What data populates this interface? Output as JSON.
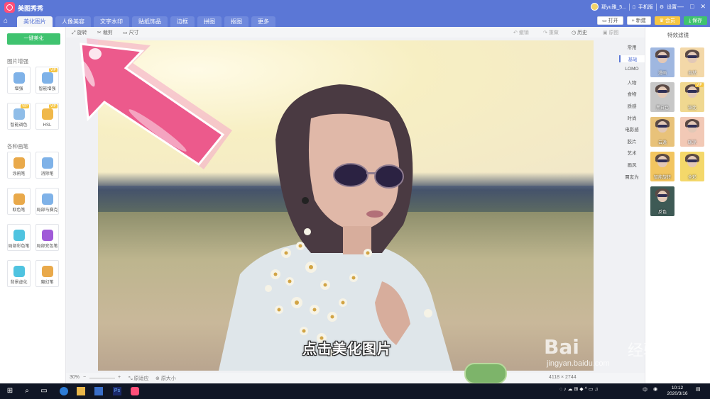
{
  "app": {
    "title": "美图秀秀",
    "user": "那yu雅_5...",
    "phone": "手机版",
    "settings": "设置"
  },
  "window_controls": [
    "—",
    "□",
    "✕"
  ],
  "tabs": [
    "美化图片",
    "人像美容",
    "文字水印",
    "贴纸饰品",
    "边框",
    "拼图",
    "抠图",
    "更多"
  ],
  "active_tab": 0,
  "top_buttons": {
    "open": "打开",
    "new": "新建",
    "vip": "会员",
    "save": "保存"
  },
  "left": {
    "auto_button": "一键美化",
    "section1": "图片增强",
    "enhance_tools": [
      {
        "label": "增强",
        "icon": "sliders-icon",
        "color": "#7fb2e8",
        "vip": ""
      },
      {
        "label": "智能增强",
        "icon": "magic-wand-icon",
        "color": "#7fb2e8",
        "vip": "VIP"
      },
      {
        "label": "智能调色",
        "icon": "palette-icon",
        "color": "#8fbde8",
        "vip": "VIP"
      },
      {
        "label": "HSL",
        "icon": "hsl-icon",
        "color": "#f0b84a",
        "vip": "VIP"
      }
    ],
    "section2": "各种画笔",
    "brush_tools": [
      {
        "label": "涂鸦笔",
        "icon": "pen-icon",
        "color": "#e9a94a"
      },
      {
        "label": "消除笔",
        "icon": "eraser-icon",
        "color": "#7fb2e8"
      },
      {
        "label": "取色笔",
        "icon": "color-picker-icon",
        "color": "#e9a94a"
      },
      {
        "label": "局部马赛克",
        "icon": "mosaic-icon",
        "color": "#7fb2e8"
      },
      {
        "label": "局部彩色笔",
        "icon": "color-brush-icon",
        "color": "#4fc3e0"
      },
      {
        "label": "局部变色笔",
        "icon": "tint-brush-icon",
        "color": "#a05ad8"
      },
      {
        "label": "背景虚化",
        "icon": "blur-icon",
        "color": "#4fc3e0"
      },
      {
        "label": "魔幻笔",
        "icon": "magic-pen-icon",
        "color": "#e9a94a"
      }
    ]
  },
  "toolbar": {
    "rotate": "旋转",
    "crop": "裁剪",
    "size": "尺寸",
    "undo": "撤销",
    "redo": "重做",
    "history": "历史",
    "compare": "原图"
  },
  "canvas": {
    "subtitle": "点击美化图片"
  },
  "statusbar": {
    "zoom": "30%",
    "fit": "原适应",
    "original": "原大小",
    "dimensions": "4118 × 2744"
  },
  "filters": {
    "title": "特效滤镜",
    "categories": [
      "常用",
      "基础",
      "LOMO",
      "人物",
      "食物",
      "质感",
      "时尚",
      "电影感",
      "胶片",
      "艺术",
      "画风",
      "賈友为"
    ],
    "active_category": 1,
    "tiles": [
      {
        "label": "漫画",
        "bg": "#9fb7e0",
        "vip": ""
      },
      {
        "label": "自然",
        "bg": "#f3d8a8",
        "vip": ""
      },
      {
        "label": "黑白色",
        "bg": "#c7c7c7",
        "vip": ""
      },
      {
        "label": "铅比",
        "bg": "#f0d890",
        "vip": "VIP"
      },
      {
        "label": "云逸",
        "bg": "#e8c27a",
        "vip": ""
      },
      {
        "label": "暖凉",
        "bg": "#f2c9b6",
        "vip": ""
      },
      {
        "label": "智能旋转",
        "bg": "#f2c560",
        "vip": ""
      },
      {
        "label": "全彩",
        "bg": "#f4d86a",
        "vip": ""
      },
      {
        "label": "反色",
        "bg": "#3e5a55",
        "vip": ""
      }
    ]
  },
  "watermark": {
    "brand": "Bai",
    "brand2": "经验",
    "url": "jingyan.baidu.com"
  },
  "taskbar": {
    "time": "10:12",
    "date": "2020/3/16",
    "ime": "中"
  }
}
